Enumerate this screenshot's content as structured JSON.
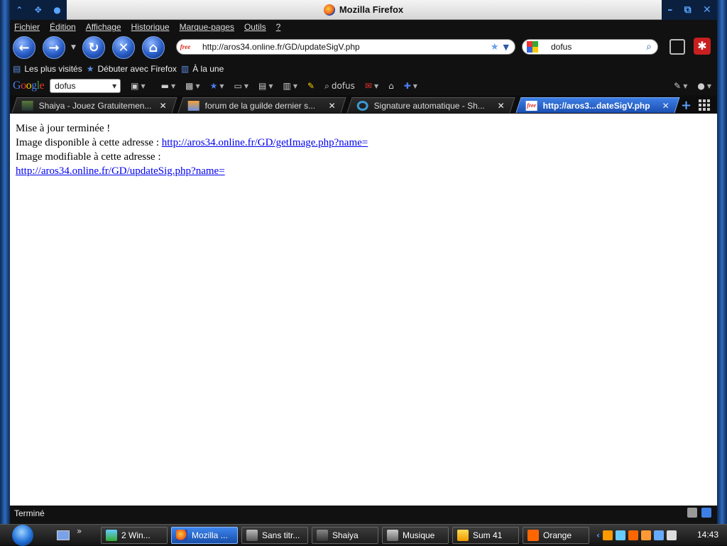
{
  "window": {
    "title": "Mozilla Firefox"
  },
  "menu": [
    "Fichier",
    "Édition",
    "Affichage",
    "Historique",
    "Marque-pages",
    "Outils",
    "?"
  ],
  "navigation": {
    "url": "http://aros34.online.fr/GD/updateSigV.php",
    "url_favicon_text": "free",
    "search_value": "dofus"
  },
  "bookmarks": [
    {
      "label": "Les plus visités",
      "icon": "bookmark-folder-icon"
    },
    {
      "label": "Débuter avec Firefox",
      "icon": "star-icon"
    },
    {
      "label": "À la une",
      "icon": "rss-folder-icon"
    }
  ],
  "google_toolbar": {
    "search_value": "dofus",
    "search_label": "dofus"
  },
  "tabs": [
    {
      "label": "Shaiya - Jouez Gratuitemen...",
      "active": false
    },
    {
      "label": "forum de la guilde dernier s...",
      "active": false
    },
    {
      "label": "Signature automatique - Sh...",
      "active": false
    },
    {
      "label": "http://aros3...dateSigV.php",
      "active": true
    }
  ],
  "content": {
    "line1": "Mise à jour terminée !",
    "line2_prefix": "Image disponible à cette adresse : ",
    "link1": "http://aros34.online.fr/GD/getImage.php?name=",
    "line3": "Image modifiable à cette adresse :",
    "link2": "http://aros34.online.fr/GD/updateSig.php?name="
  },
  "status": {
    "text": "Terminé"
  },
  "taskbar": {
    "items": [
      {
        "label": "2  Win...",
        "active": false
      },
      {
        "label": "Mozilla ...",
        "active": true
      },
      {
        "label": "Sans titr...",
        "active": false
      },
      {
        "label": "Shaiya",
        "active": false
      },
      {
        "label": "Musique",
        "active": false
      },
      {
        "label": "Sum 41",
        "active": false
      },
      {
        "label": "Orange",
        "active": false
      }
    ],
    "quicklaunch_more": "»",
    "clock": "14:43"
  }
}
